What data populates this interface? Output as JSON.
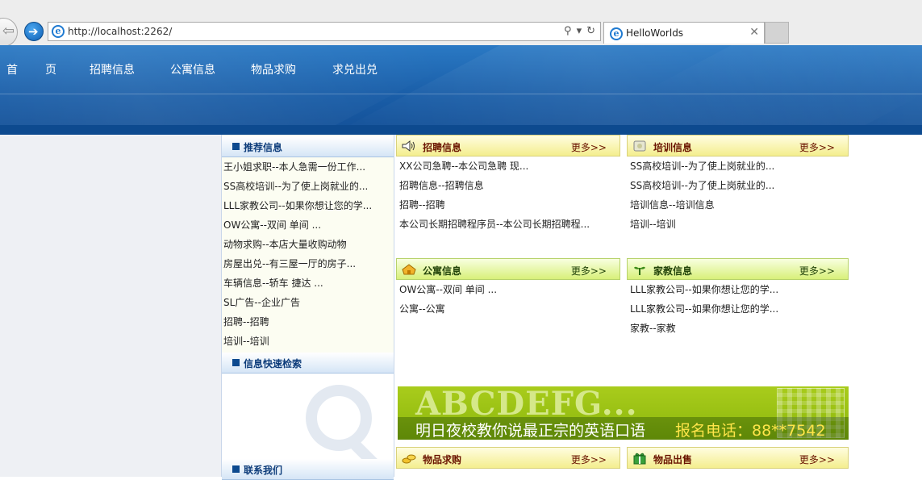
{
  "browser": {
    "url": "http://localhost:2262/",
    "tab_title": "HelloWorlds",
    "search_icon": "search-icon",
    "dropdown_icon": "chevron-down-icon",
    "refresh_icon": "refresh-icon",
    "close_icon": "close-icon"
  },
  "nav": {
    "items": [
      "首",
      "页",
      "招聘信息",
      "公寓信息",
      "物品求购",
      "求兑出兑"
    ]
  },
  "sidebar": {
    "recommend_title": "推荐信息",
    "recommend_items": [
      "王小姐求职--本人急需一份工作...",
      "SS高校培训--为了使上岗就业的...",
      "LLL家教公司--如果你想让您的学...",
      "OW公寓--双间 单间 ...",
      "动物求购--本店大量收购动物",
      "房屋出兑--有三屋一厅的房子...",
      "车辆信息--轿车 捷达 ...",
      "SL广告--企业广告",
      "招聘--招聘",
      "培训--培训"
    ],
    "search_title": "信息快速检索",
    "contact_title": "联系我们"
  },
  "panels": {
    "recruit": {
      "title": "招聘信息",
      "more": "更多>>",
      "items": [
        "XX公司急聘--本公司急聘 现...",
        "招聘信息--招聘信息",
        "招聘--招聘",
        "本公司长期招聘程序员--本公司长期招聘程..."
      ]
    },
    "training": {
      "title": "培训信息",
      "more": "更多>>",
      "items": [
        "SS高校培训--为了使上岗就业的...",
        "SS高校培训--为了使上岗就业的...",
        "培训信息--培训信息",
        "培训--培训"
      ]
    },
    "apartment": {
      "title": "公寓信息",
      "more": "更多>>",
      "items": [
        "OW公寓--双间 单间 ...",
        "公寓--公寓"
      ]
    },
    "tutor": {
      "title": "家教信息",
      "more": "更多>>",
      "items": [
        "LLL家教公司--如果你想让您的学...",
        "LLL家教公司--如果你想让您的学...",
        "家教--家教"
      ]
    },
    "buy": {
      "title": "物品求购",
      "more": "更多>>"
    },
    "sell": {
      "title": "物品出售",
      "more": "更多>>"
    }
  },
  "ad": {
    "headline": "ABCDEFG...",
    "slogan": "明日夜校教你说最正宗的英语口语",
    "phone": "报名电话：88**7542"
  }
}
